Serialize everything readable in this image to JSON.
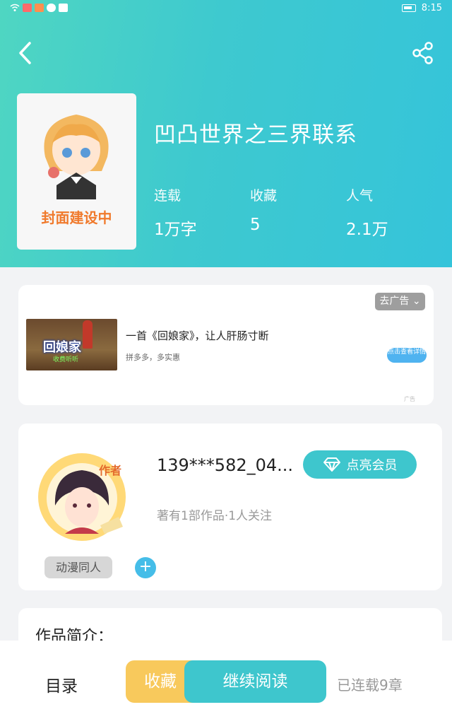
{
  "status_bar": {
    "time": "8:15"
  },
  "book": {
    "title": "凹凸世界之三界联系",
    "cover_caption": "封面建设中",
    "stats": [
      {
        "label": "连载",
        "value": "1万字"
      },
      {
        "label": "收藏",
        "value": "5"
      },
      {
        "label": "人气",
        "value": "2.1万"
      }
    ]
  },
  "ad": {
    "tag": "去广告",
    "thumb_text": "回娘家",
    "thumb_sub": "收费听听",
    "headline": "一首《回娘家》，让人肝肠寸断",
    "subline": "拼多多，多实惠",
    "cta": "点击查看详情",
    "mark": "广告"
  },
  "author": {
    "badge": "作者",
    "name": "139***582_04...",
    "vip_label": "点亮会员",
    "meta": "著有1部作品·1人关注",
    "tag": "动漫同人",
    "add_symbol": "+"
  },
  "intro": {
    "title": "作品简介："
  },
  "bottom_bar": {
    "toc": "目录",
    "collect": "收藏",
    "read": "继续阅读",
    "serial": "已连载9章"
  }
}
